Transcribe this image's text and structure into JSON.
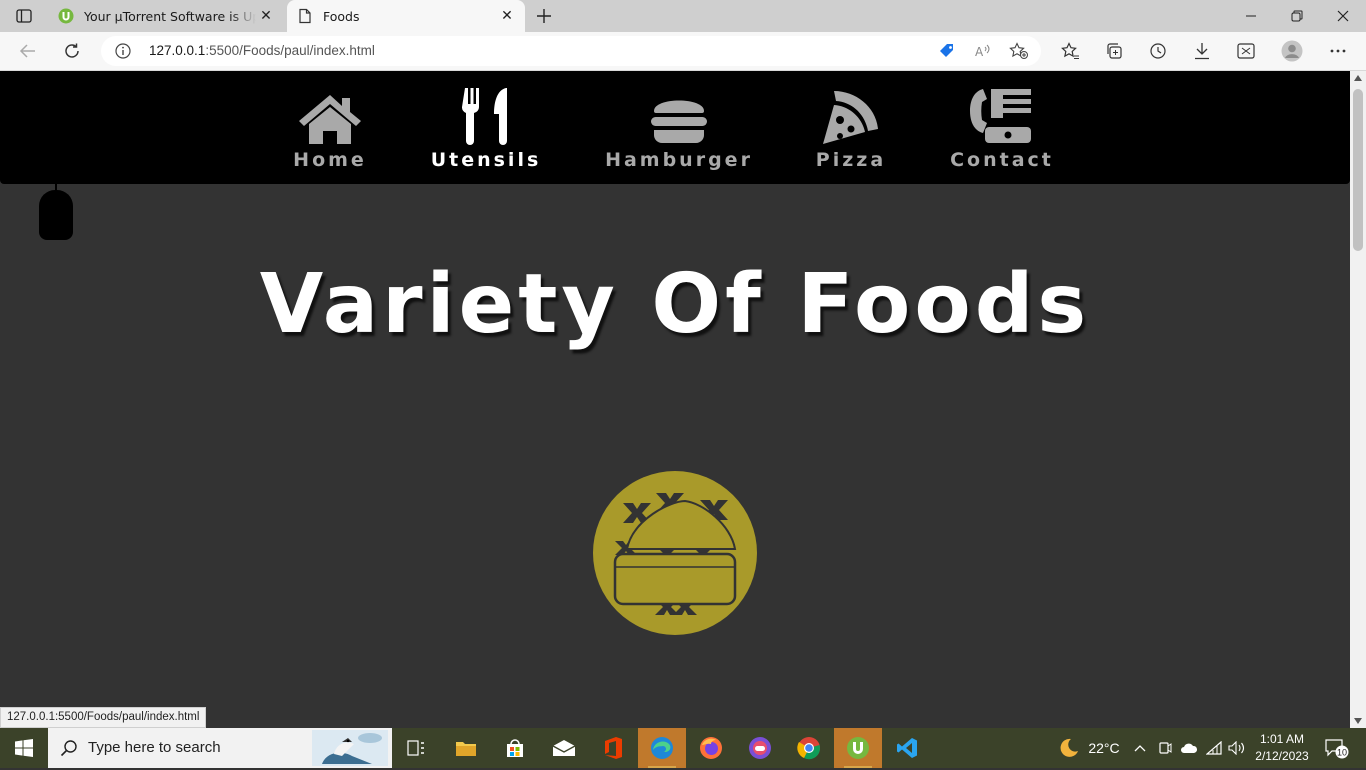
{
  "browser": {
    "tabs": [
      {
        "title": "Your µTorrent Software is Up to Date",
        "favicon": "utorrent-icon",
        "active": false
      },
      {
        "title": "Foods",
        "favicon": "page-icon",
        "active": true
      }
    ],
    "url_host": "127.0.0.1",
    "url_path": ":5500/Foods/paul/index.html",
    "status_url": "127.0.0.1:5500/Foods/paul/index.html"
  },
  "nav": {
    "items": [
      {
        "label": "Home",
        "icon": "home-icon",
        "active": false
      },
      {
        "label": "Utensils",
        "icon": "utensils-icon",
        "active": true
      },
      {
        "label": "Hamburger",
        "icon": "hamburger-icon",
        "active": false
      },
      {
        "label": "Pizza",
        "icon": "pizza-icon",
        "active": false
      },
      {
        "label": "Contact",
        "icon": "contact-icon",
        "active": false
      }
    ]
  },
  "hero": {
    "title": "Variety Of Foods"
  },
  "colors": {
    "navbar": "#000000",
    "page_bg": "#333333",
    "logo": "#a99a2a",
    "nav_inactive": "#a9a9a9",
    "nav_active": "#ffffff",
    "taskbar": "#3b4229"
  },
  "taskbar": {
    "search_placeholder": "Type here to search",
    "apps": [
      "task-view-icon",
      "file-explorer-icon",
      "store-icon",
      "mail-icon",
      "office-icon",
      "edge-icon",
      "firefox-icon",
      "game-icon",
      "chrome-icon",
      "utorrent-icon",
      "vscode-icon"
    ],
    "weather": "22°C",
    "time": "1:01 AM",
    "date": "2/12/2023",
    "notifications": "10"
  }
}
